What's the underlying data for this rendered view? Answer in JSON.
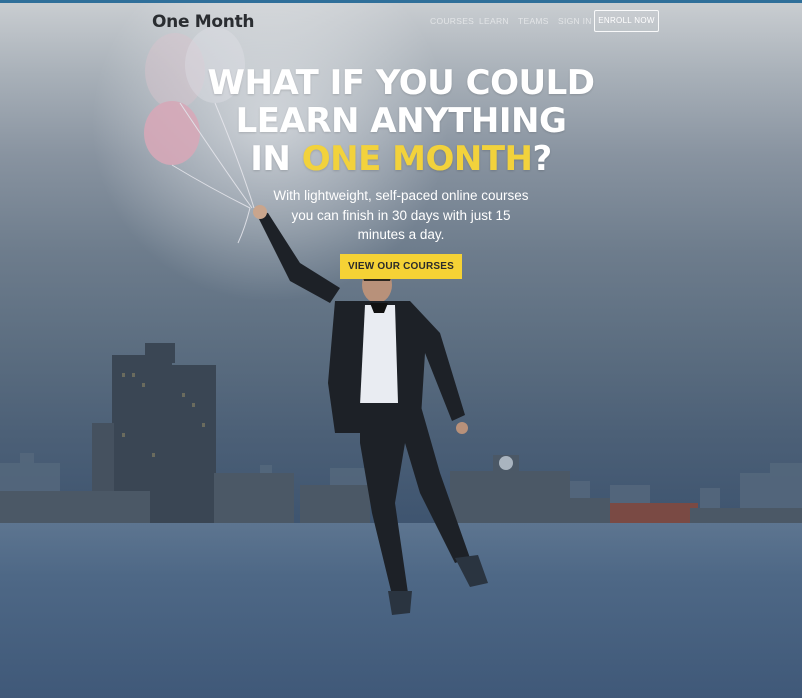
{
  "brand": {
    "logo_text": "One Month"
  },
  "nav": {
    "links": [
      "COURSES",
      "LEARN",
      "TEAMS",
      "SIGN IN"
    ],
    "enroll_label": "ENROLL NOW"
  },
  "hero": {
    "headline_line1": "WHAT IF YOU COULD",
    "headline_line2": "LEARN ANYTHING",
    "headline_line3_prefix": "IN ",
    "headline_line3_highlight": "ONE MONTH",
    "headline_line3_suffix": "?",
    "subtitle_line1": "With lightweight, self-paced online courses",
    "subtitle_line2": "you can finish in 30 days with just 15",
    "subtitle_line3": "minutes a day.",
    "cta_label": "VIEW OUR COURSES"
  },
  "colors": {
    "accent_yellow": "#f5d235",
    "highlight_text": "#f2d23c",
    "top_bar": "#2f6f9a"
  }
}
